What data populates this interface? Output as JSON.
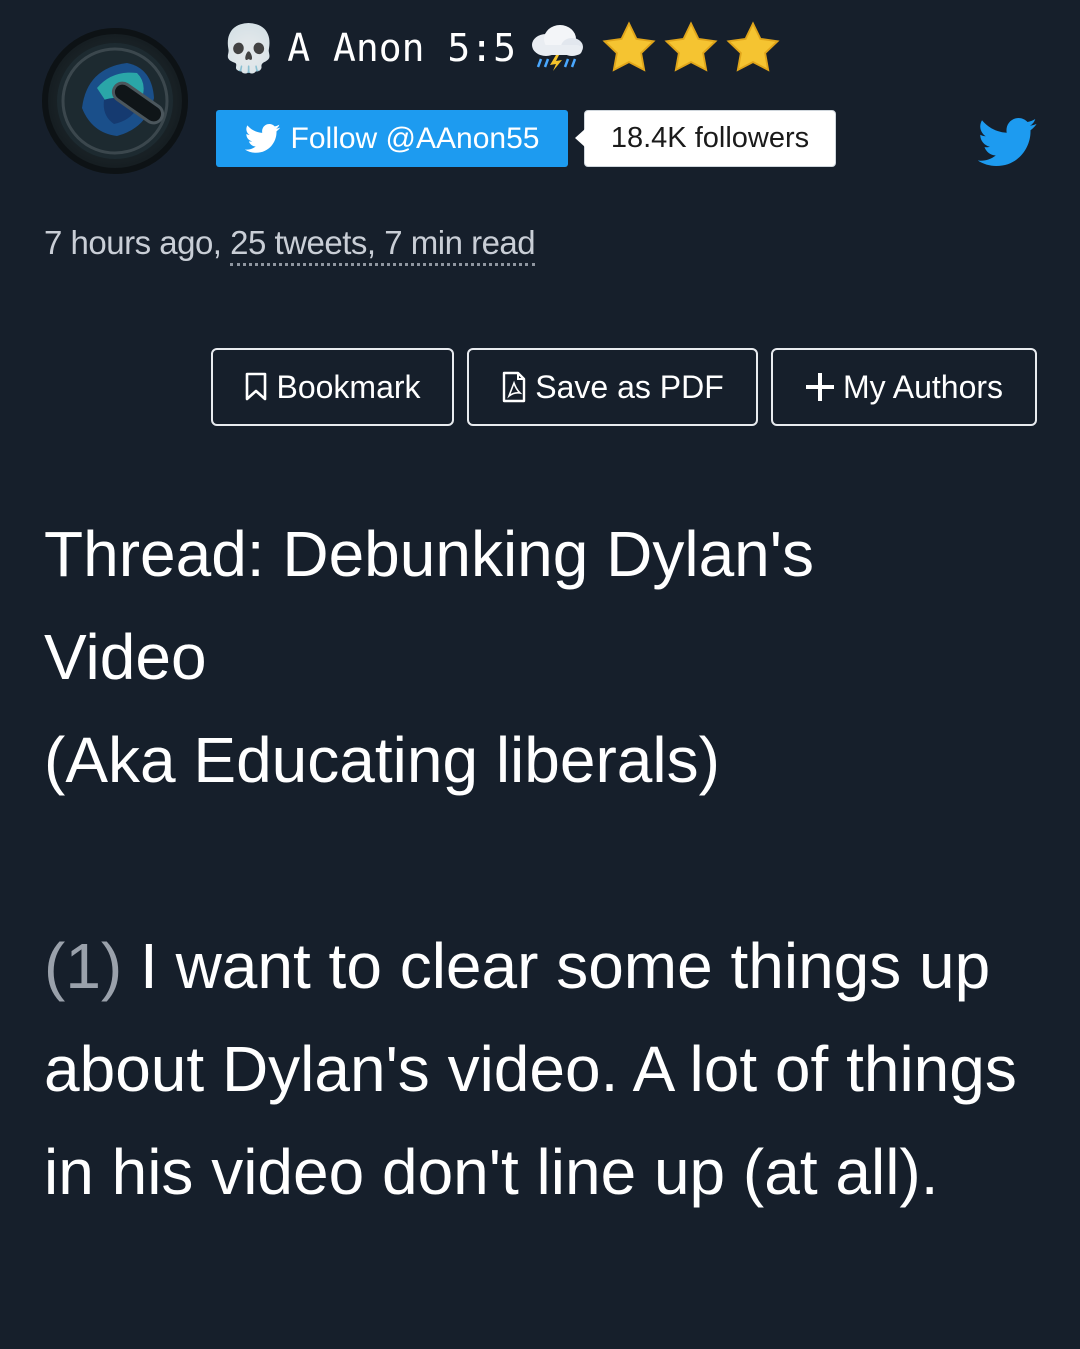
{
  "author": {
    "name": "A Anon 5:5",
    "skull_icon": "💀",
    "storm_icon": "⛈",
    "star_count": 3,
    "star_color": "#f5c431"
  },
  "follow": {
    "label": "Follow @AAnon55",
    "followers": "18.4K followers",
    "accent": "#1d9bf0"
  },
  "meta": {
    "prefix": "7 hours ago, ",
    "detail": "25 tweets, 7 min read"
  },
  "actions": {
    "bookmark": "Bookmark",
    "save_pdf": "Save as PDF",
    "my_authors": "My Authors"
  },
  "thread": {
    "title_line1": "Thread: Debunking Dylan's",
    "title_line2": "Video",
    "title_line3": "(Aka Educating liberals)"
  },
  "tweet": {
    "number": "(1)",
    "text": " I want to clear some things up about Dylan's video. A lot of things in his video don't line up (at all)."
  },
  "colors": {
    "background": "#161f2b",
    "text": "#ffffff",
    "muted": "#c9ced6"
  }
}
